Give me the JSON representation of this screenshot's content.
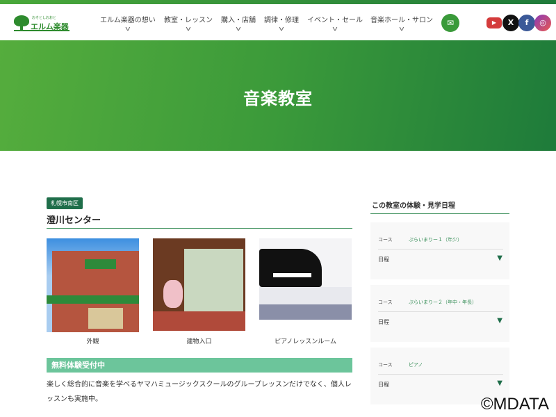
{
  "header": {
    "logo_text": "エルム楽器",
    "nav": [
      {
        "label": "エルム楽器の想い"
      },
      {
        "label": "教室・レッスン"
      },
      {
        "label": "購入・店舗"
      },
      {
        "label": "調律・修理"
      },
      {
        "label": "イベント・セール"
      },
      {
        "label": "音楽ホール・サロン"
      }
    ],
    "social": [
      "youtube-icon",
      "x-icon",
      "facebook-icon",
      "instagram-icon"
    ]
  },
  "hero": {
    "title": "音楽教室"
  },
  "center": {
    "area_badge": "札幌市南区",
    "name": "澄川センター",
    "photos": [
      {
        "caption": "外観"
      },
      {
        "caption": "建物入口"
      },
      {
        "caption": "ピアノレッスンルーム"
      }
    ],
    "banner": "無料体験受付中",
    "description": "楽しく総合的に音楽を学べるヤマハミュージックスクールのグループレッスンだけでなく、個人レッスンも実施中。"
  },
  "sidebar": {
    "heading": "この教室の体験・見学日程",
    "course_label": "コース",
    "schedule_label": "日程",
    "courses": [
      {
        "name": "ぷらいまりー１（年少）"
      },
      {
        "name": "ぷらいまりー２（年中・年長）"
      },
      {
        "name": "ピアノ"
      }
    ]
  },
  "watermark": "©MDATA",
  "colors": {
    "brand": "#2e8b2e",
    "accent": "#1f6e4a",
    "banner": "#6cc59b"
  }
}
